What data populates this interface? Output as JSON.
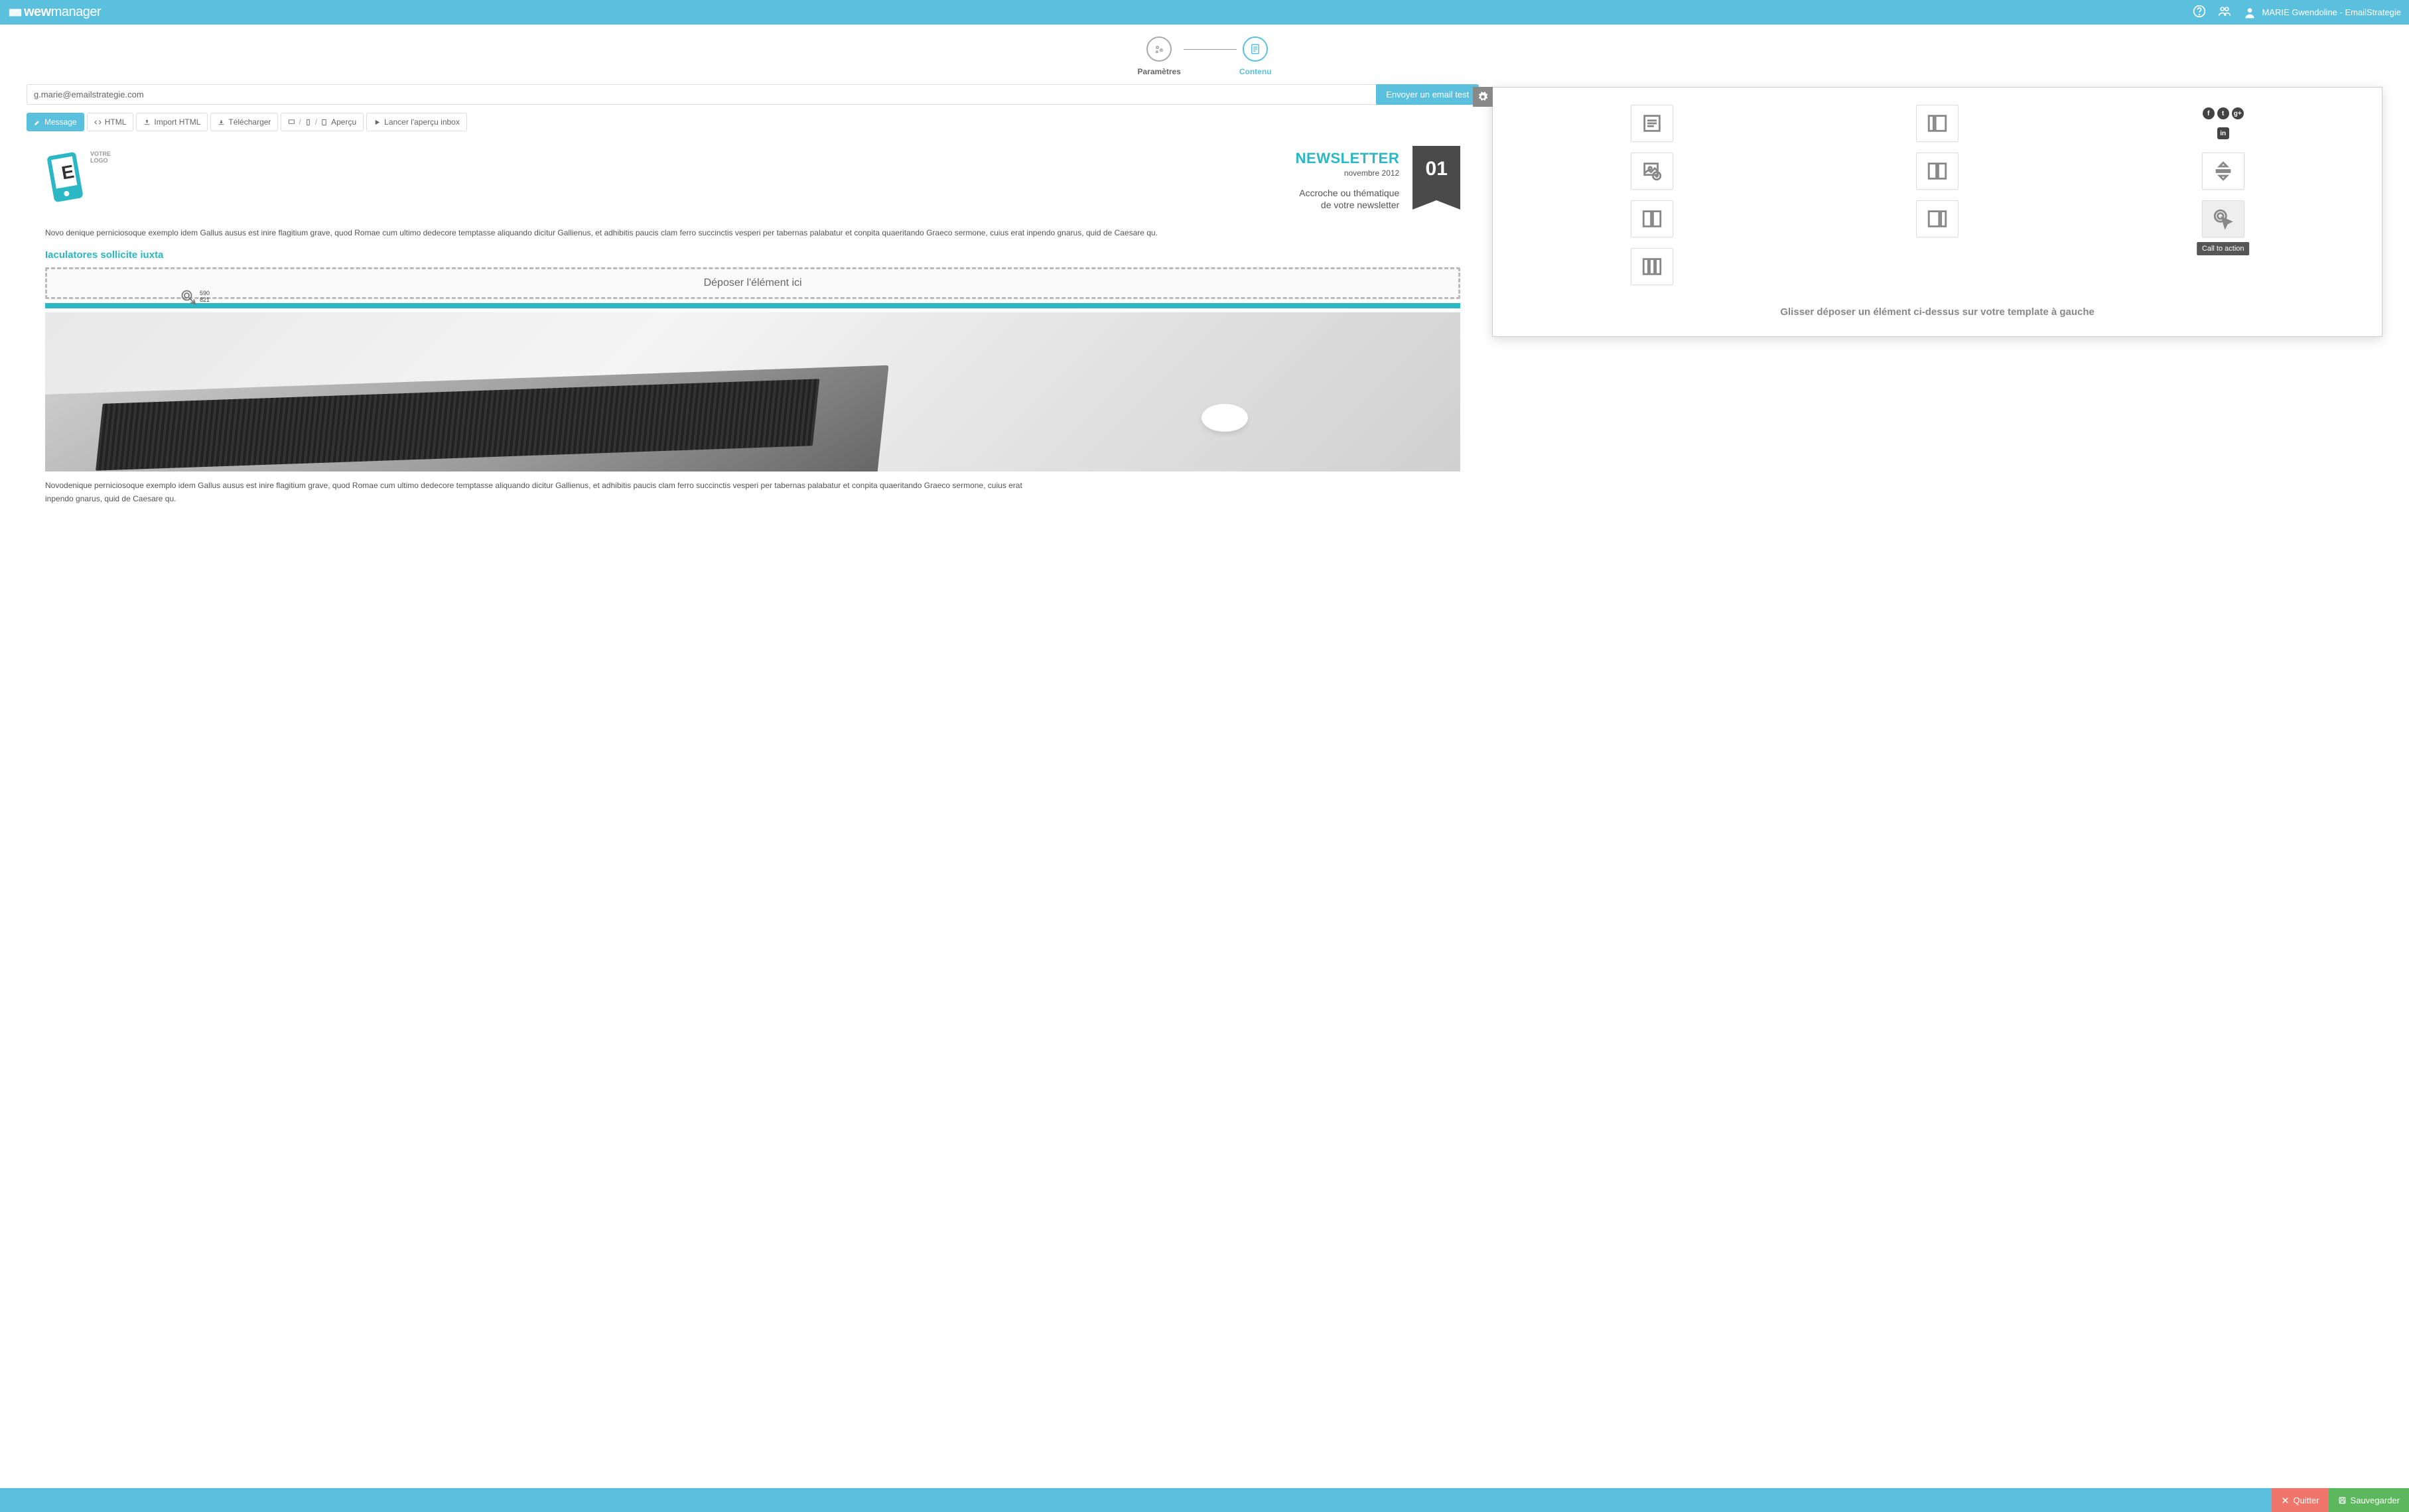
{
  "header": {
    "logo_text": "wewmanager",
    "user_label": "MARIE Gwendoline - EmailStrategie"
  },
  "steps": {
    "step1": "Paramètres",
    "step2": "Contenu"
  },
  "emailbar": {
    "value": "g.marie@emailstrategie.com",
    "send_label": "Envoyer un email test"
  },
  "tabs": {
    "message": "Message",
    "html": "HTML",
    "import_html": "Import HTML",
    "download": "Télécharger",
    "preview": "Aperçu",
    "launch_inbox": "Lancer l'aperçu inbox"
  },
  "newsletter": {
    "logo_hint_line1": "VOTRE",
    "logo_hint_line2": "LOGO",
    "title": "NEWSLETTER",
    "date": "novembre 2012",
    "tagline_line1": "Accroche ou thématique",
    "tagline_line2": "de votre newsletter",
    "issue_number": "01",
    "para1": "Novo denique perniciosoque exemplo idem Gallus ausus est inire flagitium grave, quod Romae cum ultimo dedecore temptasse aliquando dicitur Gallienus, et adhibitis paucis clam ferro succinctis vesperi per tabernas palabatur et conpita quaeritando Graeco sermone, cuius erat inpendo gnarus, quid de Caesare qu.",
    "subhead": "Iaculatores sollicite iuxta",
    "drop_label": "Déposer l'élément ici",
    "drop_coords": "590\n821",
    "para2": "Novodenique perniciosoque exemplo idem Gallus ausus est inire flagitium grave, quod Romae cum ultimo dedecore temptasse aliquando dicitur Gallienus, et adhibitis paucis clam ferro succinctis vesperi per tabernas palabatur et conpita quaeritando Graeco sermone, cuius erat",
    "para2b": "inpendo gnarus, quid de Caesare qu."
  },
  "widgets": {
    "tooltip_cta": "Call to action",
    "hint": "Glisser déposer un élément ci-dessus sur votre template à gauche"
  },
  "footer": {
    "quit": "Quitter",
    "save": "Sauvegarder"
  }
}
